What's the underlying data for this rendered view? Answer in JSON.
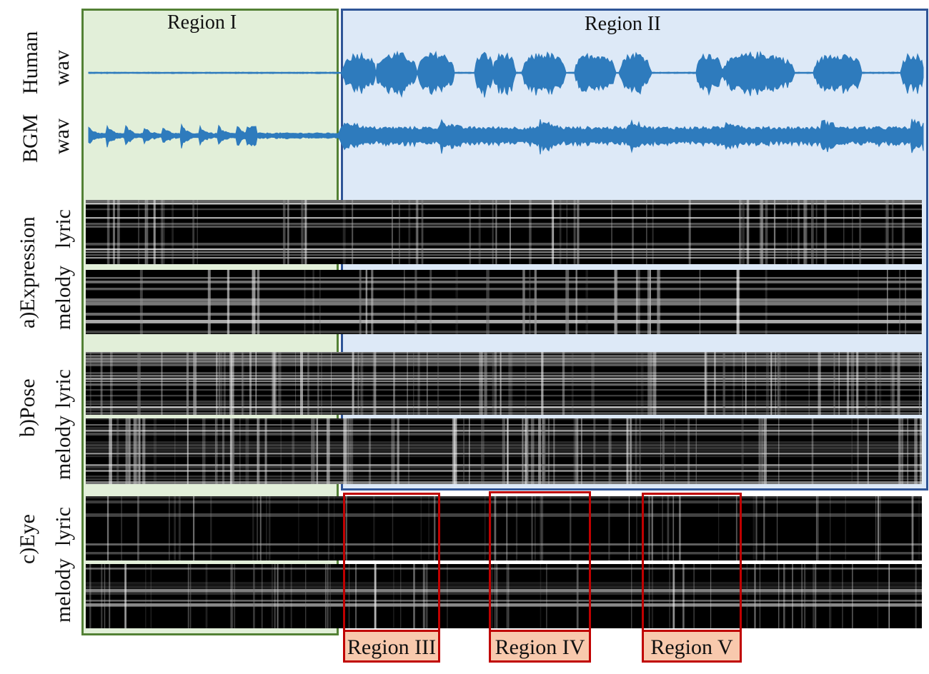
{
  "regions": {
    "region1": "Region I",
    "region2": "Region II",
    "region3": "Region III",
    "region4": "Region IV",
    "region5": "Region V"
  },
  "row_labels": {
    "human": "Human",
    "wav1": "wav",
    "bgm": "BGM",
    "wav2": "wav",
    "expression": "a)Expression",
    "lyric_a": "lyric",
    "melody_a": "melody",
    "pose": "b)Pose",
    "lyric_b": "lyric",
    "melody_b": "melody",
    "eye": "c)Eye",
    "lyric_c": "lyric",
    "melody_c": "melody"
  },
  "colors": {
    "region1_fill": "#e2efd9",
    "region1_border": "#538135",
    "region2_fill": "#dde9f7",
    "region2_border": "#2f5597",
    "highlight_border": "#c00000",
    "highlight_fill": "#f8c9ad",
    "waveform": "#2e7bbd"
  }
}
